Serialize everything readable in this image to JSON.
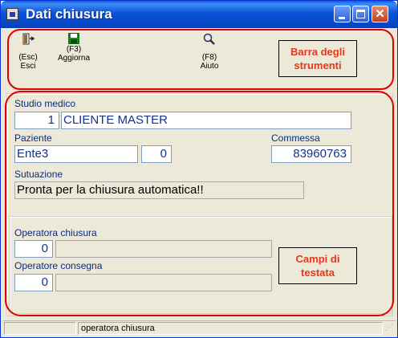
{
  "window": {
    "title": "Dati chiusura"
  },
  "toolbar": {
    "items": [
      {
        "key": "(Esc)",
        "label": "Esci",
        "icon": "exit-door-icon"
      },
      {
        "key": "(F3)",
        "label": "Aggiorna",
        "icon": "save-floppy-icon"
      },
      {
        "key": "(F8)",
        "label": "Aiuto",
        "icon": "magnifier-help-icon"
      }
    ],
    "callout": "Barra degli strumenti"
  },
  "form": {
    "studio_label": "Studio medico",
    "studio_code": "1",
    "studio_name": "CLIENTE MASTER",
    "paziente_label": "Paziente",
    "paziente_value": "Ente3",
    "paziente_code": "0",
    "commessa_label": "Commessa",
    "commessa_value": "83960763",
    "situazione_label": "Sutuazione",
    "situazione_value": "Pronta per la chiusura automatica!!",
    "op_chiusura_label": "Operatora chiusura",
    "op_chiusura_code": "0",
    "op_chiusura_name": "",
    "op_consegna_label": "Operatore consegna",
    "op_consegna_code": "0",
    "op_consegna_name": "",
    "callout": "Campi di testata"
  },
  "statusbar": {
    "text": "operatora chiusura"
  },
  "colors": {
    "annotation_red": "#e00000",
    "callout_text": "#e8361b",
    "label_blue": "#0a2a80",
    "field_text": "#16318c"
  }
}
